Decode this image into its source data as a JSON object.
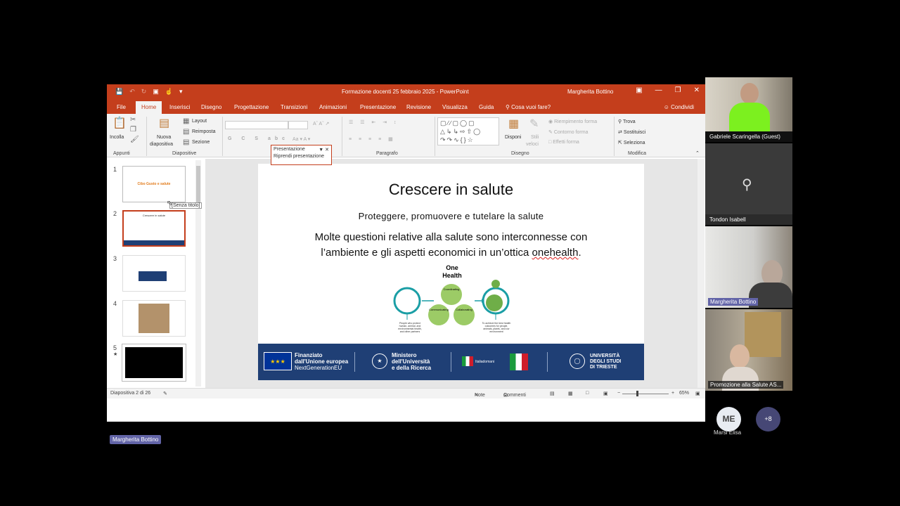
{
  "titlebar": {
    "doc_title": "Formazione docenti 25 febbraio 2025 - PowerPoint",
    "user_name": "Margherita Bottino",
    "qat_icons": [
      "save-icon",
      "undo-icon",
      "redo-icon",
      "present-icon",
      "touch-icon",
      "customize-icon"
    ],
    "window_controls": [
      "ribbon-display-icon",
      "minimize-icon",
      "restore-icon",
      "close-icon"
    ]
  },
  "tabs": [
    "File",
    "Home",
    "Inserisci",
    "Disegno",
    "Progettazione",
    "Transizioni",
    "Animazioni",
    "Presentazione",
    "Revisione",
    "Visualizza",
    "Guida"
  ],
  "active_tab": "Home",
  "tell_me": "Cosa vuoi fare?",
  "share_label": "Condividi",
  "ribbon": {
    "paste": "Incolla",
    "new_slide": "Nuova",
    "new_slide2": "diapositiva",
    "layout": "Layout",
    "reset": "Reimposta",
    "section": "Sezione",
    "font_buttons": "G C S abc",
    "arrange": "Disponi",
    "quick_styles": "Stili",
    "quick_styles2": "veloci",
    "shape_fill": "Riempimento forma",
    "shape_outline": "Contorno forma",
    "shape_effects": "Effetti forma",
    "find": "Trova",
    "replace": "Sostituisci",
    "select": "Seleziona",
    "groups": [
      "Appunti",
      "Diapositive",
      "Paragrafo",
      "Disegno",
      "Modifica"
    ]
  },
  "popup": {
    "title": "Presentazione",
    "action": "Riprendi presentazione"
  },
  "thumbnails": {
    "numbers": [
      "1",
      "2",
      "3",
      "4",
      "5"
    ],
    "tooltip": "[Senza titolo]",
    "slide1_title": "Cibo Gusto e salute",
    "slide2_title": "Crescere in salute",
    "slide5_mark": "★"
  },
  "slide": {
    "title": "Crescere in salute",
    "subtitle": "Proteggere, promuovere e tutelare la salute",
    "body_line1": "Molte questioni relative alla salute sono interconnesse con",
    "body_line2a": "l’ambiente e gli aspetti economici in un’ottica ",
    "body_line2b": "onehealth",
    "body_line2c": ".",
    "graphic_title": "One",
    "graphic_title2": "Health",
    "circle_labels": [
      "Coordinating",
      "Communicating",
      "Collaborating"
    ],
    "left_caption": "People who protect human, animal, and environmental health, and other partners",
    "right_caption": "To achieve the best health outcomes for people, animals, plants, and our environment",
    "footer": {
      "eu_line1": "Finanziato",
      "eu_line2": "dall'Unione europea",
      "eu_line3": "NextGenerationEU",
      "mur_line1": "Ministero",
      "mur_line2": "dell'Università",
      "mur_line3": "e della Ricerca",
      "italia": "Italiadomani",
      "uni_line1": "UNIVERSITÀ",
      "uni_line2": "DEGLI STUDI",
      "uni_line3": "DI TRIESTE"
    }
  },
  "statusbar": {
    "slide_info": "Diapositiva 2 di 26",
    "notes": "Note",
    "comments": "Commenti",
    "zoom": "65%"
  },
  "participants": [
    {
      "name": "Gabriele Scaringella (Guest)"
    },
    {
      "name": "Tondon Isabell"
    },
    {
      "name": "Margherita Bottino"
    },
    {
      "name": "Promozione alla Salute AS..."
    }
  ],
  "avatar": {
    "initials": "ME",
    "name": "Marsi Elisa"
  },
  "more_count": "+8",
  "presenter": "Margherita Bottino",
  "colors": {
    "ppt_accent": "#c43e1c",
    "footer_blue": "#1f3f75",
    "teams_purple": "#6264a7"
  }
}
